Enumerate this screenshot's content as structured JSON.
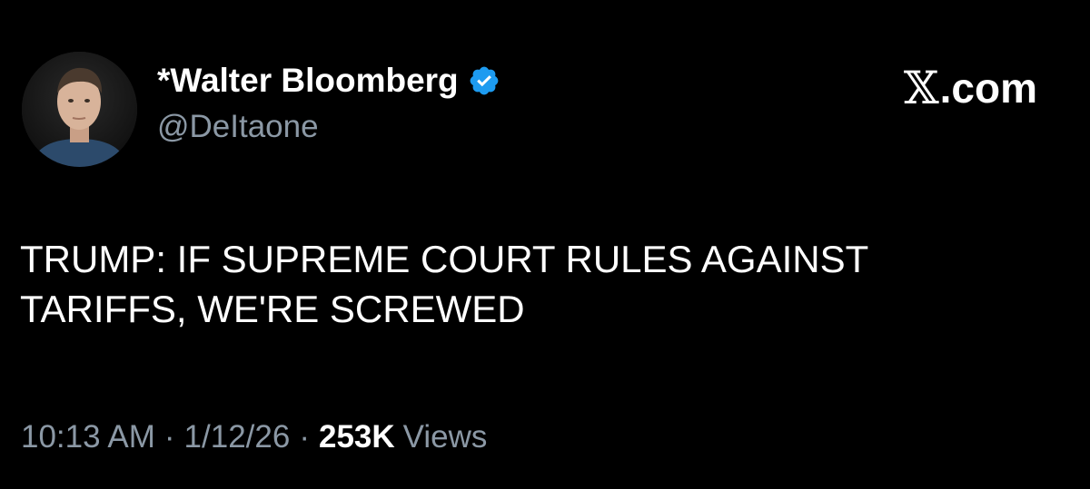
{
  "author": {
    "display_name": "*Walter Bloomberg",
    "handle": "@DeItaone",
    "verified_icon": "verified-badge-icon",
    "verified_color": "#1d9bf0"
  },
  "brand": {
    "glyph": "𝕏",
    "label": ".com"
  },
  "tweet": {
    "lines": [
      "TRUMP: IF SUPREME COURT RULES AGAINST",
      "TARIFFS, WE'RE SCREWED"
    ]
  },
  "meta": {
    "time": "10:13 AM",
    "separator": "·",
    "date": "1/12/26",
    "views_count": "253K",
    "views_label": "Views"
  },
  "colors": {
    "background": "#000000",
    "text": "#ffffff",
    "secondary_text": "#8b98a5"
  }
}
